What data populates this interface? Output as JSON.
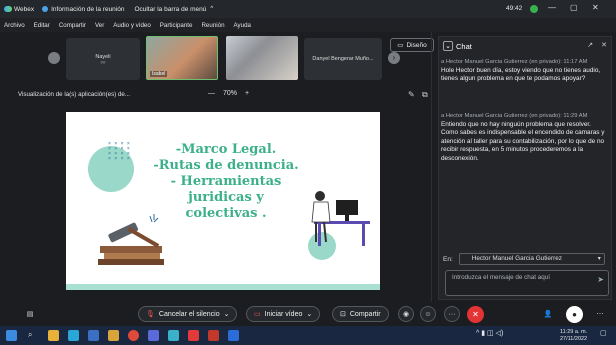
{
  "titlebar": {
    "app_name": "Webex",
    "meeting_info": "Información de la reunión",
    "hide_menu": "Ocultar la barra de menú",
    "timer": "49:42",
    "minimize": "—",
    "maximize": "▢",
    "close": "✕"
  },
  "menu": [
    "Archivo",
    "Editar",
    "Compartir",
    "Ver",
    "Audio y vídeo",
    "Participante",
    "Reunión",
    "Ayuda"
  ],
  "participants": {
    "tile1_name": "Nayeli",
    "tile1_sub": "##",
    "tile2_label": "Isabel",
    "tile4_name": "Danyel Bengerar Muño...",
    "layout_button": "Diseño",
    "next_label": "›"
  },
  "share": {
    "title": "Visualización de la(s) aplicación(es) de...",
    "zoom_minus": "—",
    "zoom_value": "70%",
    "zoom_plus": "+"
  },
  "slide": {
    "lines": [
      "-Marco Legal.",
      "-Rutas de denuncia.",
      "- Herramientas",
      "juridicas y",
      "colectivas ."
    ]
  },
  "chat": {
    "title": "Chat",
    "messages": [
      {
        "meta": "a Hector Manuel Garcia Gutierrez (en privado):  11:17 AM",
        "text": "Hole Hector buen día, estoy viendo que no tienes audio, tienes algun problema en que te podamos apoyar?"
      },
      {
        "meta": "a Hector Manuel Garcia Gutierrez (en privado):  11:29 AM",
        "text": "Entiendo que no hay ninguún problema que resolver. Como sabes es indispensable el encendido de camaras y atención al taller para su contabilización, por lo que de no recibir respuesta, en 5 minutos procederemos a la desconexión."
      }
    ],
    "to_label": "En:",
    "to_value": "Hector Manuel Garcia Gutierrez",
    "input_placeholder": "Introduzca el mensaje de chat aquí"
  },
  "controls": {
    "unmute": "Cancelar el silencio",
    "start_video": "Iniciar vídeo",
    "share": "Compartir",
    "more": "···"
  },
  "taskbar": {
    "time": "11:29 a. m.",
    "date": "27/11/2022"
  },
  "colors": {
    "accent_green": "#3bb08a",
    "mint": "#9ad9c9",
    "end_red": "#e23434"
  }
}
